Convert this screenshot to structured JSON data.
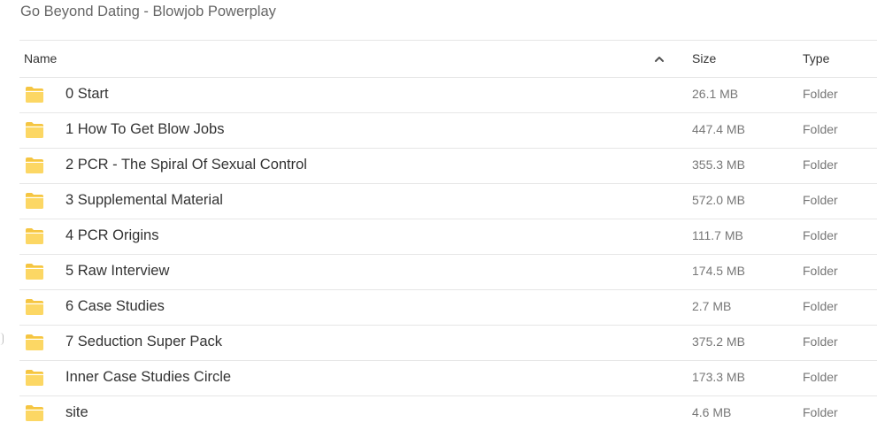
{
  "title": "Go Beyond Dating - Blowjob Powerplay",
  "columns": {
    "name": "Name",
    "size": "Size",
    "type": "Type"
  },
  "rows": [
    {
      "name": "0 Start",
      "size": "26.1 MB",
      "type": "Folder"
    },
    {
      "name": "1 How To Get Blow Jobs",
      "size": "447.4 MB",
      "type": "Folder"
    },
    {
      "name": "2 PCR - The Spiral Of Sexual Control",
      "size": "355.3 MB",
      "type": "Folder"
    },
    {
      "name": "3 Supplemental Material",
      "size": "572.0 MB",
      "type": "Folder"
    },
    {
      "name": "4 PCR Origins",
      "size": "111.7 MB",
      "type": "Folder"
    },
    {
      "name": "5 Raw Interview",
      "size": "174.5 MB",
      "type": "Folder"
    },
    {
      "name": "6 Case Studies",
      "size": "2.7 MB",
      "type": "Folder"
    },
    {
      "name": "7 Seduction Super Pack",
      "size": "375.2 MB",
      "type": "Folder"
    },
    {
      "name": "Inner Case Studies Circle",
      "size": "173.3 MB",
      "type": "Folder"
    },
    {
      "name": "site",
      "size": "4.6 MB",
      "type": "Folder"
    }
  ],
  "icons": {
    "folder": "folder-icon",
    "sort": "chevron-up-icon"
  },
  "colors": {
    "folder_fill": "#fcd764",
    "folder_tab": "#f5c542",
    "divider": "#e6e6e6"
  }
}
